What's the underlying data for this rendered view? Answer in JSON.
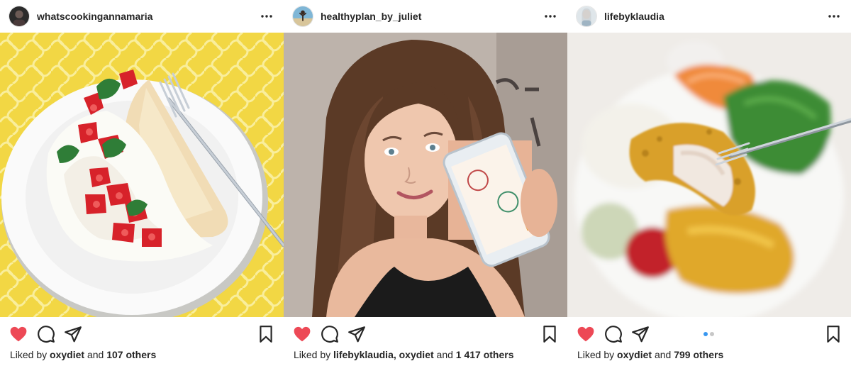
{
  "colors": {
    "like_red": "#ed4956",
    "icon_dark": "#262626",
    "carousel_active": "#3897f0",
    "carousel_inactive": "#c7c7c7"
  },
  "icons": {
    "more": "more-options-icon",
    "like": "heart-filled-icon",
    "comment": "comment-bubble-icon",
    "share": "paper-plane-icon",
    "save": "bookmark-icon"
  },
  "posts": [
    {
      "username": "whatscookingannamaria",
      "photo": "crepe with cottage cheese and strawberries on a white plate",
      "liked": true,
      "likes": {
        "prefix": "Liked by",
        "user": "oxydiet",
        "and": "and",
        "count": "107 others"
      }
    },
    {
      "username": "healthyplan_by_juliet",
      "photo": "young woman selfie holding a phone with a diet app",
      "liked": true,
      "likes": {
        "prefix": "Liked by",
        "user": "lifebyklaudia, oxydiet",
        "and": "and",
        "count": "1 417 others"
      }
    },
    {
      "username": "lifebyklaudia",
      "photo": "plate with rice, curry chicken, salad and a fork",
      "liked": true,
      "carousel": {
        "count": 2,
        "active": 1
      },
      "likes": {
        "prefix": "Liked by",
        "user": "oxydiet",
        "and": "and",
        "count": "799 others"
      }
    }
  ]
}
